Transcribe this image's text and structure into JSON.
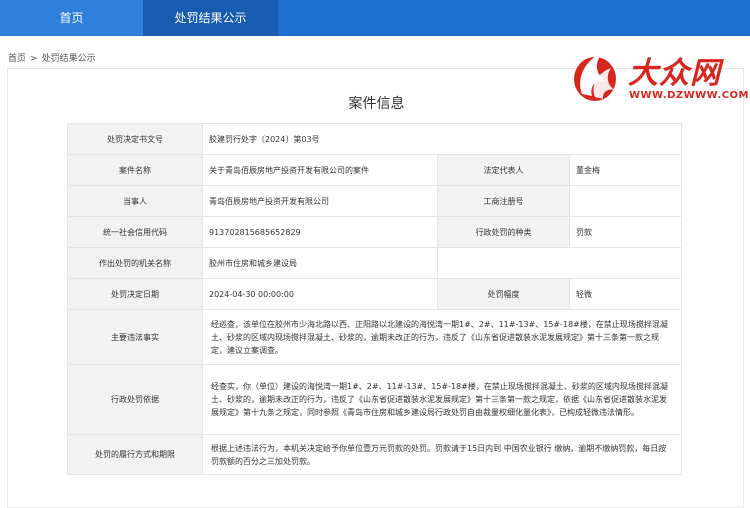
{
  "nav": {
    "home": "首页",
    "penalty": "处罚结果公示"
  },
  "breadcrumb": {
    "home": "首页",
    "separator": ">",
    "current": "处罚结果公示"
  },
  "logo": {
    "text": "大众网",
    "url": "WWW.DZWWW.COM",
    "color": "#d7261e"
  },
  "page_title": "案件信息",
  "colors": {
    "nav_bg": "#1f6fcf",
    "nav_active": "#175cb0",
    "label_bg": "#f2f2f2",
    "border": "#e4e4e4",
    "logo_red": "#d7261e"
  },
  "fields": {
    "doc_no": {
      "label": "处罚决定书文号",
      "value": "胶建罚行处字〔2024〕第03号"
    },
    "case_name": {
      "label": "案件名称",
      "value": "关于青岛佰辰房地产投资开发有限公司的案件"
    },
    "legal_rep": {
      "label": "法定代表人",
      "value": "董金梅"
    },
    "party": {
      "label": "当事人",
      "value": "青岛佰辰房地产投资开发有限公司"
    },
    "reg_no": {
      "label": "工商注册号",
      "value": ""
    },
    "credit_code": {
      "label": "统一社会信用代码",
      "value": "913702815685652829"
    },
    "penalty_type": {
      "label": "行政处罚的种类",
      "value": "罚款"
    },
    "authority": {
      "label": "作出处罚的机关名称",
      "value": "胶州市住房和城乡建设局"
    },
    "decision_date": {
      "label": "处罚决定日期",
      "value": "2024-04-30 00:00:00"
    },
    "penalty_range": {
      "label": "处罚幅度",
      "value": "轻微"
    },
    "facts": {
      "label": "主要违法事实",
      "value": "经巡查，该单位在胶州市少海北路以西、正阳路以北建设的海悦湾一期1#、2#、11#-13#、15#-18#楼，在禁止现场搅拌混凝土、砂浆的区域内现场搅拌混凝土、砂浆的，逾期未改正的行为，违反了《山东省促进散装水泥发展规定》第十三条第一款之规定，建议立案调查。"
    },
    "basis": {
      "label": "行政处罚依据",
      "value": "经查实，你（单位）建设的海悦湾一期1#、2#、11#-13#、15#-18#楼，在禁止现场搅拌混凝土、砂浆的区域内现场搅拌混凝土、砂浆的，逾期未改正的行为，违反了《山东省促进散装水泥发展规定》第十三条第一款之规定，依据《山东省促进散装水泥发展规定》第十九条之规定，同时参照《青岛市住房和城乡建设局行政处罚自由裁量权细化量化表》，已构成轻微违法情形。"
    },
    "performance": {
      "label": "处罚的履行方式和期限",
      "value": "根据上述违法行为，本机关决定给予你单位壹万元罚款的处罚。罚款请于15日内到 中国农业银行 缴纳，逾期不缴纳罚款，每日按罚款额的百分之三加处罚款。"
    }
  }
}
